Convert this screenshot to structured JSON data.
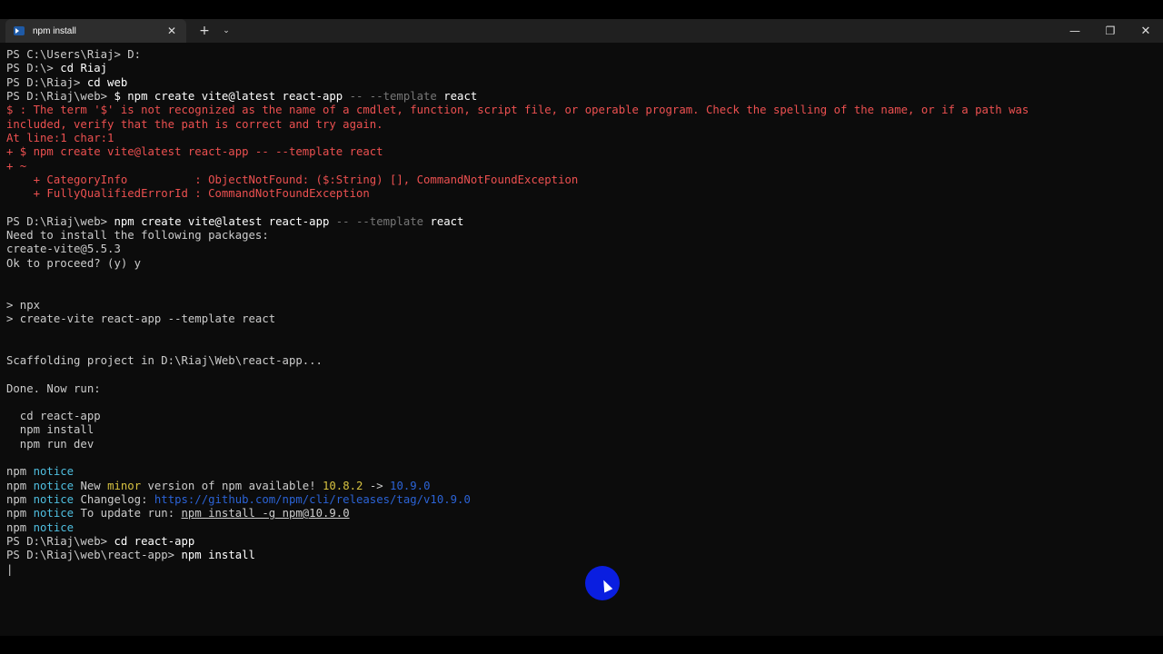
{
  "tab": {
    "title": "npm install",
    "close": "✕",
    "new_tab": "+",
    "dropdown": "⌄"
  },
  "window_controls": {
    "minimize": "—",
    "maximize": "❐",
    "close": "✕"
  },
  "terminal": {
    "lines": [
      [
        {
          "t": "PS C:\\Users\\Riaj> D:"
        }
      ],
      [
        {
          "t": "PS D:\\> "
        },
        {
          "t": "cd Riaj",
          "s": "w"
        }
      ],
      [
        {
          "t": "PS D:\\Riaj> "
        },
        {
          "t": "cd web",
          "s": "w"
        }
      ],
      [
        {
          "t": "PS D:\\Riaj\\web> "
        },
        {
          "t": "$ npm create vite@latest react-app ",
          "s": "w"
        },
        {
          "t": "-- --template ",
          "s": "g"
        },
        {
          "t": "react",
          "s": "w"
        }
      ],
      [
        {
          "t": "$ : The term '$' is not recognized as the name of a cmdlet, function, script file, or operable program. Check the spelling of the name, or if a path was",
          "s": "r"
        }
      ],
      [
        {
          "t": "included, verify that the path is correct and try again.",
          "s": "r"
        }
      ],
      [
        {
          "t": "At line:1 char:1",
          "s": "r"
        }
      ],
      [
        {
          "t": "+ $ npm create vite@latest react-app -- --template react",
          "s": "r"
        }
      ],
      [
        {
          "t": "+ ~",
          "s": "r"
        }
      ],
      [
        {
          "t": "    + CategoryInfo          : ObjectNotFound: ($:String) [], CommandNotFoundException",
          "s": "r"
        }
      ],
      [
        {
          "t": "    + FullyQualifiedErrorId : CommandNotFoundException",
          "s": "r"
        }
      ],
      [],
      [
        {
          "t": "PS D:\\Riaj\\web> "
        },
        {
          "t": "npm create vite@latest react-app ",
          "s": "w"
        },
        {
          "t": "-- --template ",
          "s": "g"
        },
        {
          "t": "react",
          "s": "w"
        }
      ],
      [
        {
          "t": "Need to install the following packages:"
        }
      ],
      [
        {
          "t": "create-vite@5.5.3"
        }
      ],
      [
        {
          "t": "Ok to proceed? (y) y"
        }
      ],
      [],
      [],
      [
        {
          "t": "> npx"
        }
      ],
      [
        {
          "t": "> create-vite react-app --template react"
        }
      ],
      [],
      [],
      [
        {
          "t": "Scaffolding project in D:\\Riaj\\Web\\react-app..."
        }
      ],
      [],
      [
        {
          "t": "Done. Now run:"
        }
      ],
      [],
      [
        {
          "t": "  cd react-app"
        }
      ],
      [
        {
          "t": "  npm install"
        }
      ],
      [
        {
          "t": "  npm run dev"
        }
      ],
      [],
      [
        {
          "t": "npm "
        },
        {
          "t": "notice",
          "s": "c"
        }
      ],
      [
        {
          "t": "npm "
        },
        {
          "t": "notice",
          "s": "c"
        },
        {
          "t": " New "
        },
        {
          "t": "minor",
          "s": "y"
        },
        {
          "t": " version of npm available! "
        },
        {
          "t": "10.8.2",
          "s": "y"
        },
        {
          "t": " -> "
        },
        {
          "t": "10.9.0",
          "s": "b"
        }
      ],
      [
        {
          "t": "npm "
        },
        {
          "t": "notice",
          "s": "c"
        },
        {
          "t": " Changelog: "
        },
        {
          "t": "https://github.com/npm/cli/releases/tag/v10.9.0",
          "s": "b"
        }
      ],
      [
        {
          "t": "npm "
        },
        {
          "t": "notice",
          "s": "c"
        },
        {
          "t": " To update run: "
        },
        {
          "t": "npm install -g npm@10.9.0",
          "s": "u"
        }
      ],
      [
        {
          "t": "npm "
        },
        {
          "t": "notice",
          "s": "c"
        }
      ],
      [
        {
          "t": "PS D:\\Riaj\\web> "
        },
        {
          "t": "cd react-app",
          "s": "w"
        }
      ],
      [
        {
          "t": "PS D:\\Riaj\\web\\react-app> "
        },
        {
          "t": "npm install",
          "s": "w"
        }
      ],
      [
        {
          "t": "|",
          "s": "cursor-bar"
        }
      ]
    ]
  },
  "colors": {
    "background": "#0c0c0c",
    "titlebar": "#202020",
    "error": "#ec5050",
    "notice": "#4fbfe0",
    "version_old": "#d7c241",
    "version_new": "#2b63d6",
    "mouse_highlight": "#0a1ee0"
  },
  "icons": [
    "powershell-icon",
    "close-icon",
    "plus-icon",
    "chevron-down-icon",
    "minimize-icon",
    "maximize-icon",
    "mouse-pointer-icon"
  ]
}
